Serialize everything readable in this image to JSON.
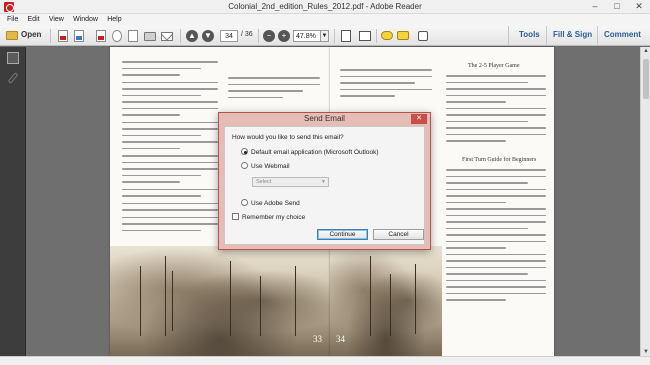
{
  "window": {
    "title": "Colonial_2nd_edition_Rules_2012.pdf - Adobe Reader",
    "min": "–",
    "max": "□",
    "close": "✕"
  },
  "menu": [
    "File",
    "Edit",
    "View",
    "Window",
    "Help"
  ],
  "toolbar": {
    "open_label": "Open",
    "page_current": "34",
    "page_total": "/ 36",
    "zoom": "47.8%",
    "zoom_out": "−",
    "zoom_in": "+",
    "links": [
      "Tools",
      "Fill & Sign",
      "Comment"
    ]
  },
  "document": {
    "left_page_number": "33",
    "right_page_number": "34",
    "right_heading_1": "The 2-5 Player Game",
    "right_heading_2": "First Turn Guide for Beginners"
  },
  "dialog": {
    "title": "Send Email",
    "close": "✕",
    "question": "How would you like to send this email?",
    "options": [
      {
        "label": "Default email application (Microsoft Outlook)",
        "checked": true
      },
      {
        "label": "Use Webmail",
        "checked": false
      },
      {
        "label": "Use Adobe Send",
        "checked": false
      }
    ],
    "webmail_select_placeholder": "Select",
    "remember_label": "Remember my choice",
    "continue_label": "Continue",
    "cancel_label": "Cancel"
  }
}
